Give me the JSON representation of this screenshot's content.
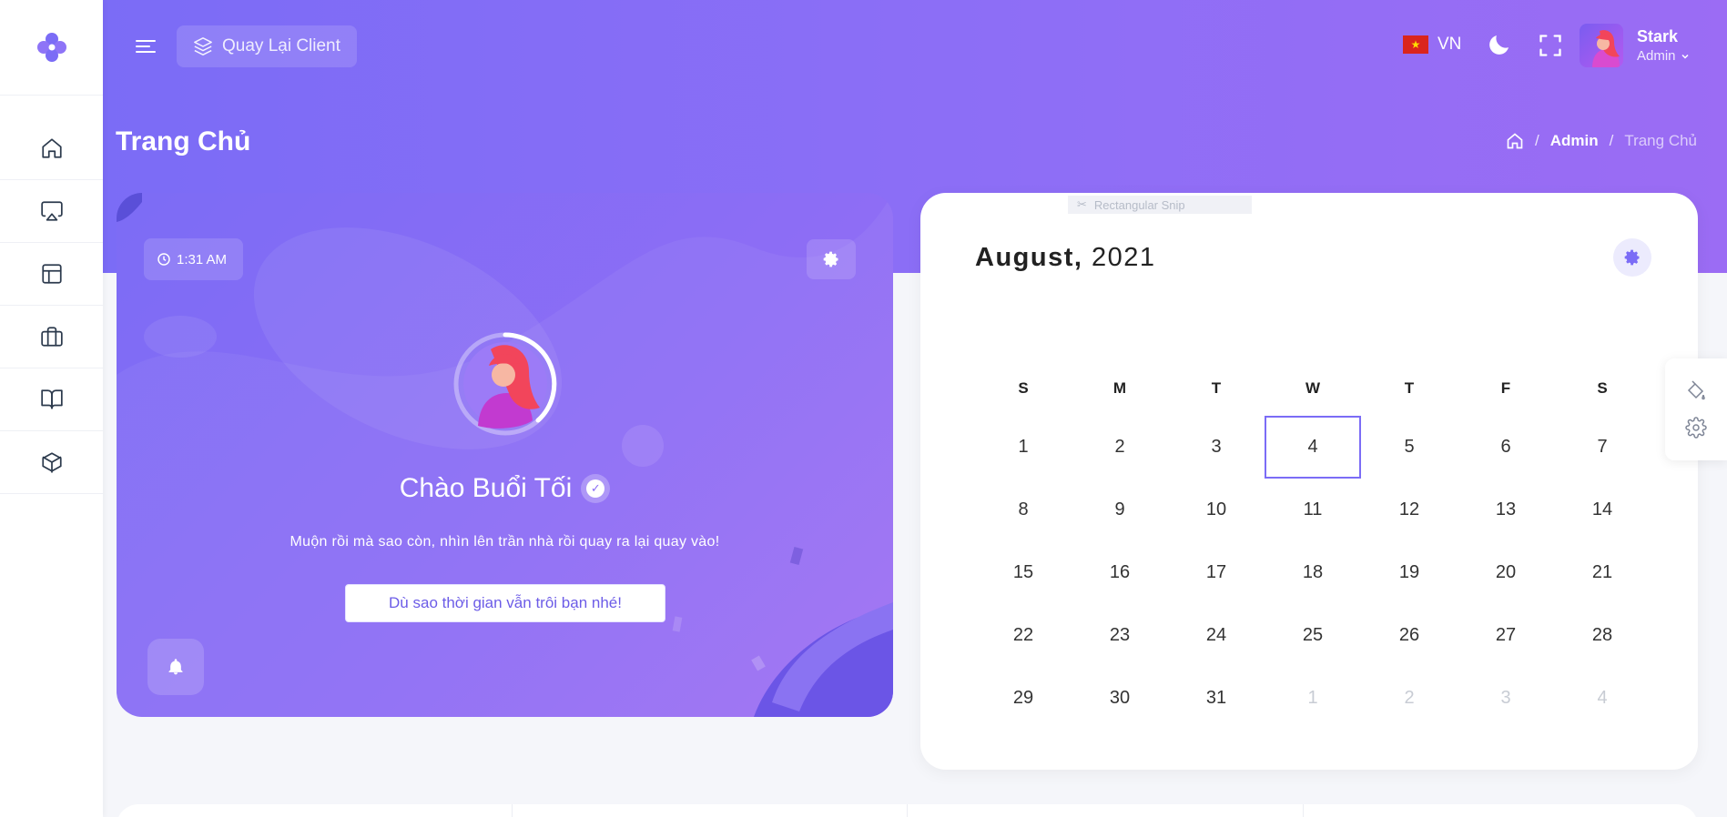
{
  "header": {
    "back_label": "Quay Lại Client",
    "lang_label": "VN",
    "user_name": "Stark",
    "user_role": "Admin"
  },
  "page": {
    "title": "Trang Chủ",
    "breadcrumb": [
      "Admin",
      "Trang Chủ"
    ]
  },
  "greeting": {
    "time": "1:31 AM",
    "title": "Chào Buổi Tối",
    "subtitle": "Muộn rồi mà sao còn, nhìn lên trần nhà rồi quay ra lại quay vào!",
    "button_label": "Dù sao thời gian vẫn trôi bạn nhé!"
  },
  "calendar": {
    "month": "August,",
    "year": "2021",
    "snip_label": "Rectangular Snip",
    "weekdays": [
      "S",
      "M",
      "T",
      "W",
      "T",
      "F",
      "S"
    ],
    "days": [
      {
        "d": "1"
      },
      {
        "d": "2"
      },
      {
        "d": "3"
      },
      {
        "d": "4",
        "today": true
      },
      {
        "d": "5"
      },
      {
        "d": "6"
      },
      {
        "d": "7"
      },
      {
        "d": "8"
      },
      {
        "d": "9"
      },
      {
        "d": "10"
      },
      {
        "d": "11"
      },
      {
        "d": "12"
      },
      {
        "d": "13"
      },
      {
        "d": "14"
      },
      {
        "d": "15"
      },
      {
        "d": "16"
      },
      {
        "d": "17"
      },
      {
        "d": "18"
      },
      {
        "d": "19"
      },
      {
        "d": "20"
      },
      {
        "d": "21"
      },
      {
        "d": "22"
      },
      {
        "d": "23"
      },
      {
        "d": "24"
      },
      {
        "d": "25"
      },
      {
        "d": "26"
      },
      {
        "d": "27"
      },
      {
        "d": "28"
      },
      {
        "d": "29"
      },
      {
        "d": "30"
      },
      {
        "d": "31"
      },
      {
        "d": "1",
        "muted": true
      },
      {
        "d": "2",
        "muted": true
      },
      {
        "d": "3",
        "muted": true
      },
      {
        "d": "4",
        "muted": true
      }
    ]
  },
  "colors": {
    "accent": "#7b6cf6",
    "gradient_end": "#9b6cf4"
  },
  "icons": {
    "sidebar": [
      "home-icon",
      "airplay-icon",
      "layout-icon",
      "briefcase-icon",
      "book-open-icon",
      "box-icon"
    ]
  }
}
